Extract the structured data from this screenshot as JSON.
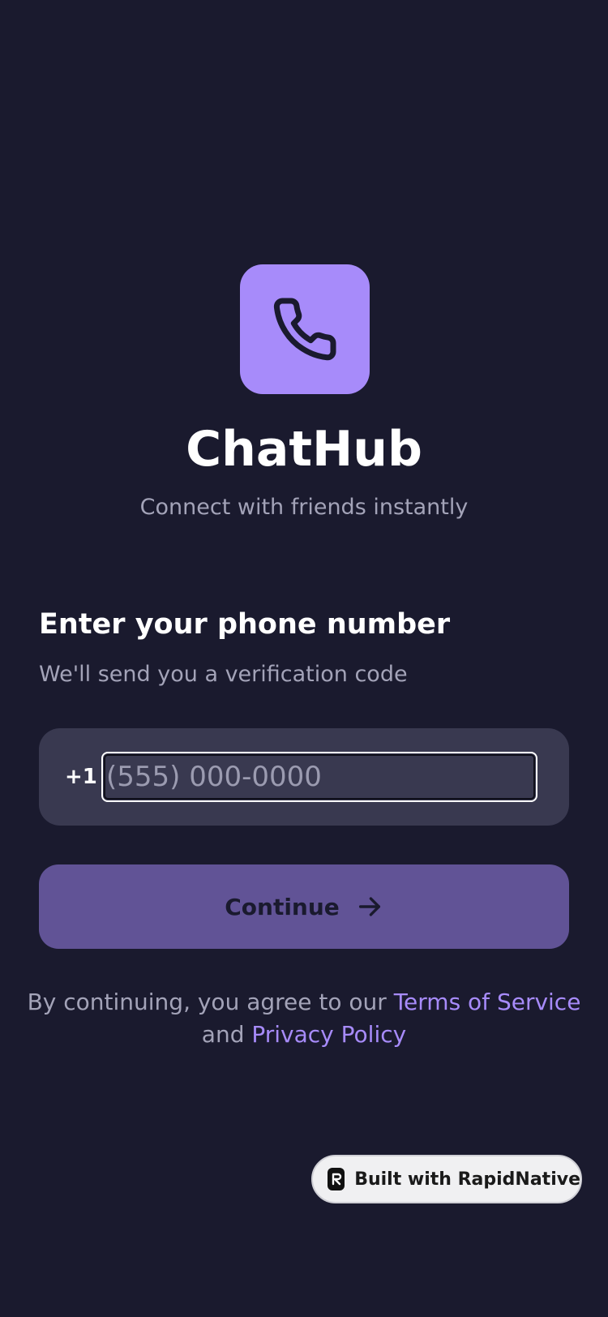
{
  "app": {
    "title": "ChatHub",
    "subtitle": "Connect with friends instantly",
    "logo_icon": "phone-icon"
  },
  "form": {
    "heading": "Enter your phone number",
    "subheading": "We'll send you a verification code",
    "country_code": "+1",
    "phone_placeholder": "(555) 000-0000",
    "phone_value": "",
    "continue_label": "Continue",
    "continue_icon": "arrow-right-icon"
  },
  "legal": {
    "prefix": "By continuing, you agree to our ",
    "terms_link": "Terms of Service",
    "middle": " and ",
    "privacy_link": "Privacy Policy"
  },
  "badge": {
    "text": "Built with RapidNative",
    "icon": "rapidnative-logo-icon"
  },
  "colors": {
    "background": "#1a1a2e",
    "accent": "#a78bfa",
    "button": "#615396",
    "input_surface": "#393950",
    "muted_text": "#a3a3b8"
  }
}
